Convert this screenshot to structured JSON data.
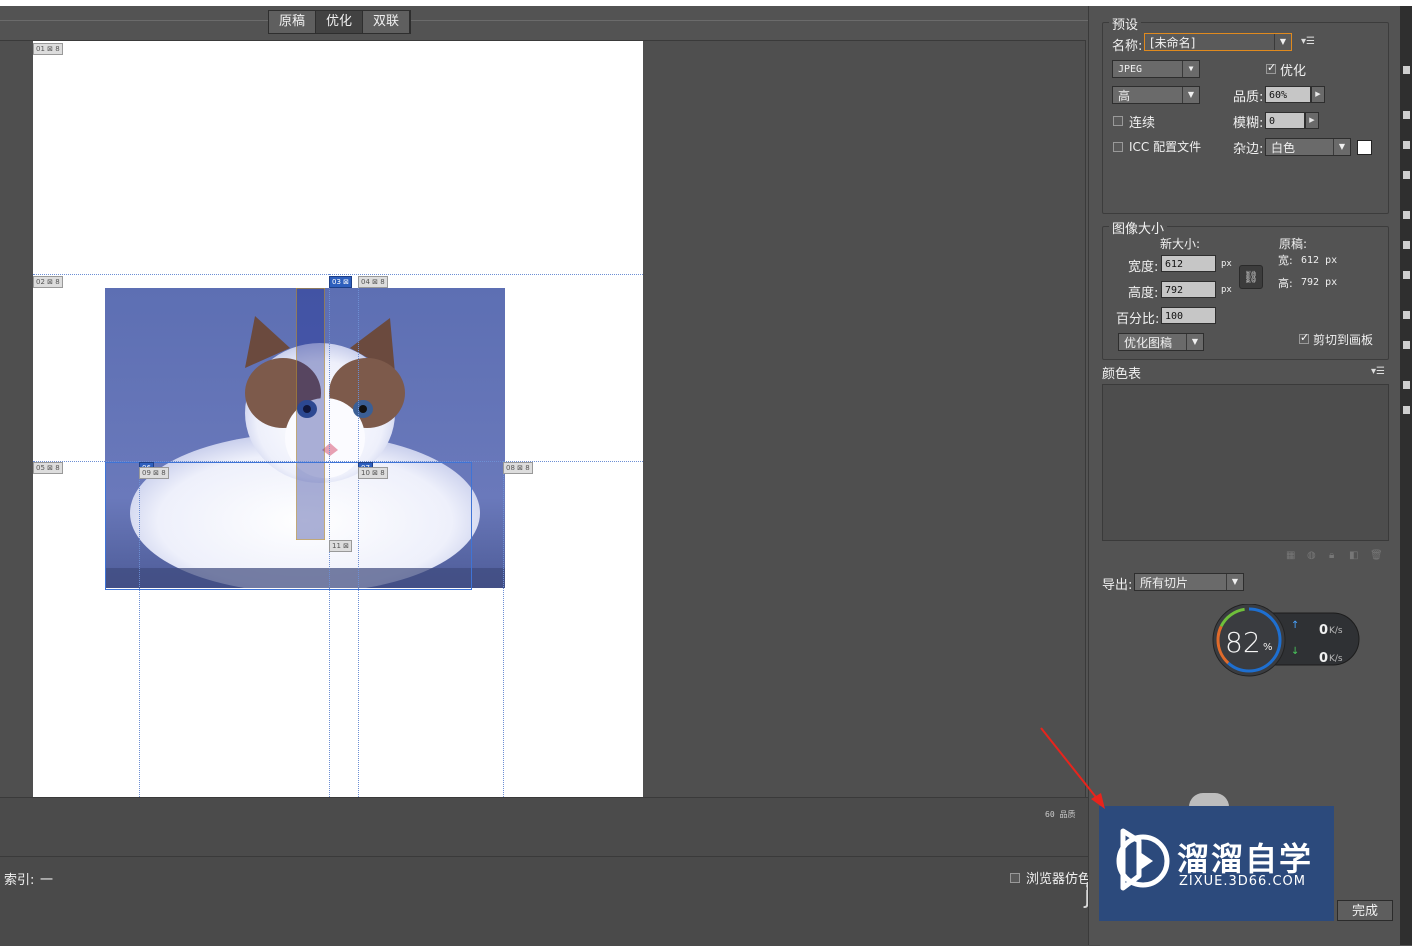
{
  "view_tabs": [
    "原稿",
    "优化",
    "双联"
  ],
  "slices": {
    "s01": "01",
    "s02": "02",
    "s03": "03",
    "s04": "04",
    "s05": "05",
    "s06": "06",
    "s07": "07",
    "s08": "08",
    "s09": "09",
    "s10": "10",
    "s11": "11"
  },
  "status": {
    "quality_text": "60 品质",
    "index_label": "索引:",
    "index_value": "一"
  },
  "preset": {
    "legend": "预设",
    "name_label": "名称:",
    "name_value": "[未命名]",
    "format": "JPEG",
    "optimize_label": "优化",
    "quality_level": "高",
    "quality_label": "品质:",
    "quality_value": "60%",
    "progressive_label": "连续",
    "blur_label": "模糊:",
    "blur_value": "0",
    "icc_label": "ICC 配置文件",
    "matte_label": "杂边:",
    "matte_value": "白色"
  },
  "image_size": {
    "legend": "图像大小",
    "new_size_label": "新大小:",
    "original_label": "原稿:",
    "width_label": "宽度:",
    "width_value": "612",
    "height_label": "高度:",
    "height_value": "792",
    "percent_label": "百分比:",
    "percent_value": "100",
    "px": "px",
    "orig_width_label": "宽:",
    "orig_width_value": "612 px",
    "orig_height_label": "高:",
    "orig_height_value": "792 px",
    "resample": "优化图稿",
    "clip_label": "剪切到画板"
  },
  "color_table": {
    "title": "颜色表"
  },
  "export": {
    "label": "导出:",
    "value": "所有切片"
  },
  "speed": {
    "percent": "82",
    "unit": "%",
    "up": "0",
    "down": "0",
    "rate_unit": "K/s"
  },
  "bottom": {
    "browser_dither": "浏览器仿色",
    "done": "完成",
    "j_char": "ji"
  },
  "watermark": {
    "brand": "溜溜自学",
    "url": "ZIXUE.3D66.COM"
  },
  "colors": {
    "annotation_arrow": "#e8241c",
    "slice_line": "#6d8fd4",
    "selection": "#3f74d6",
    "watermark_bg": "#2c4a7c"
  }
}
